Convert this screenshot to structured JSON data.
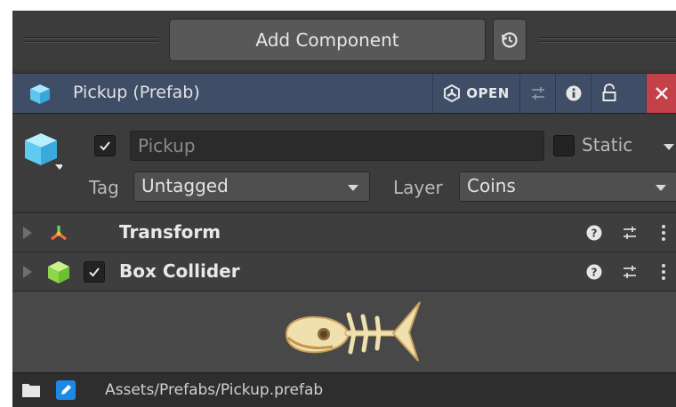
{
  "toolbar": {
    "add_component_label": "Add Component",
    "history_icon": "history-icon"
  },
  "header": {
    "title": "Pickup (Prefab)",
    "open_label": "OPEN",
    "accent": "#3f4e66",
    "close_color": "#c4414a"
  },
  "object": {
    "active_checked": true,
    "name_value": "Pickup",
    "static_label": "Static",
    "static_checked": false,
    "tag_label": "Tag",
    "tag_value": "Untagged",
    "layer_label": "Layer",
    "layer_value": "Coins"
  },
  "components": [
    {
      "name": "Transform",
      "icon": "transform-icon"
    },
    {
      "name": "Box Collider",
      "icon": "box-collider-icon",
      "enabled": true
    }
  ],
  "footer": {
    "path": "Assets/Prefabs/Pickup.prefab"
  }
}
